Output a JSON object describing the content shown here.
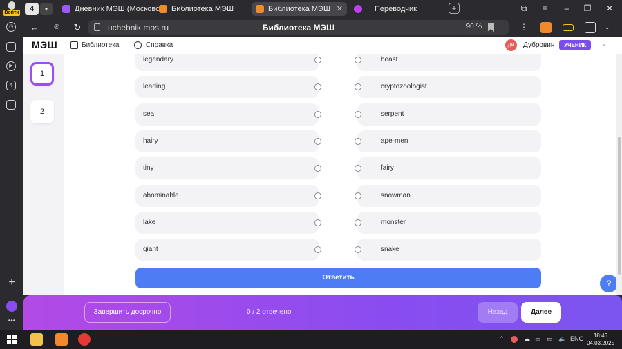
{
  "browser": {
    "profile_label": "Войти",
    "tab_count": "4",
    "tabs": [
      {
        "title": "Дневник МЭШ (Московс",
        "fav": "#9b59f5"
      },
      {
        "title": "Библиотека МЭШ",
        "fav": "#f08a2c"
      },
      {
        "title": "Библиотека МЭШ",
        "fav": "#f08a2c"
      },
      {
        "title": "Переводчик",
        "fav": "#c03ff0"
      }
    ],
    "close_tab": "✕",
    "new_tab": "+",
    "url": "uchebnik.mos.ru",
    "page_title": "Библиотека МЭШ",
    "zoom": "90 %",
    "rail_badge": "4"
  },
  "site": {
    "logo": "МЭШ",
    "nav": [
      {
        "label": "Библиотека",
        "icon": "book-icon"
      },
      {
        "label": "Справка",
        "icon": "help-circle-icon"
      }
    ],
    "user": {
      "initials": "ДИ",
      "name": "Дубровин",
      "role": "УЧЕНИК"
    }
  },
  "questions": [
    {
      "label": "1",
      "current": true
    },
    {
      "label": "2",
      "current": false
    }
  ],
  "matching": {
    "left": [
      "legendary",
      "leading",
      "sea",
      "hairy",
      "tiny",
      "abominable",
      "lake",
      "giant"
    ],
    "right": [
      "beast",
      "cryptozoologist",
      "serpent",
      "ape-men",
      "fairy",
      "snowman",
      "monster",
      "snake"
    ]
  },
  "submit_label": "Ответить",
  "help_label": "?",
  "actions": {
    "finish_label": "Завершить досрочно",
    "progress": "0 / 2 отвечено",
    "back_label": "Назад",
    "next_label": "Далее"
  },
  "taskbar": {
    "lang": "ENG",
    "time": "18:46",
    "date": "04.03.2025"
  },
  "colors": {
    "accent": "#4d7cf4",
    "purple": "#9a4ef5",
    "role_badge": "#7b4df0"
  }
}
